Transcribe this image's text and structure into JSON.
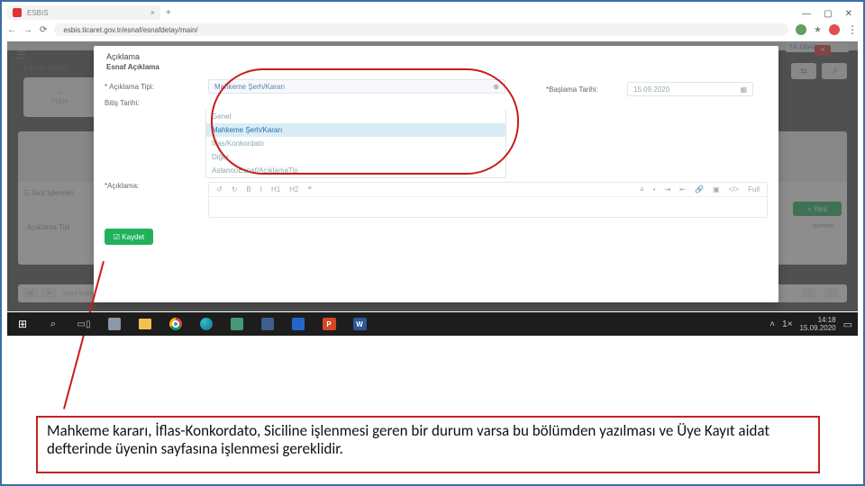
{
  "browser": {
    "tab_title": "ESBIS",
    "url": "esbis.ticaret.gov.tr/esnaf/esnafdetay/main/",
    "win_min": "—",
    "win_max": "▢",
    "win_close": "✕",
    "nav_back": "←",
    "nav_fwd": "→",
    "nav_reload": "⟳"
  },
  "app": {
    "right_card1": "T.K. ODACI",
    "close_x": "×",
    "card_title": "Esnaf Detay",
    "left_card_plus": "+",
    "left_card_label": "Yükle",
    "small_btn_a": "⇆",
    "small_btn_b": "↗",
    "sicil": "☷  Sicil İşlemleri",
    "yeni": "+ Yeni",
    "aciklama_tip_hdr": "Açıklama Tipi",
    "islem": "İşlemler",
    "footer_count": "Kayıt bulunamamaktadır"
  },
  "modal": {
    "title": "Açıklama",
    "subtitle": "Esnaf Açıklama",
    "lbl_tip": "Açıklama Tipi:",
    "lbl_bitis": "Bitiş Tarihi:",
    "lbl_baslama": "Başlama Tarihi:",
    "date_val": "15.09.2020",
    "lbl_aciklama": "Açıklama:",
    "selected": "Mahkeme Şerh/Kararı",
    "opts": [
      "Genel",
      "Mahkeme Şerh/Kararı",
      "İflas/Konkordato",
      "Diğer",
      "AstanooEsnaf/AçıklamaTip"
    ],
    "toolbar": {
      "undo": "↺",
      "redo": "↻",
      "b": "B",
      "i": "I",
      "h1": "H1",
      "h2": "H2",
      "q": "❝",
      "ol": "≡",
      "ul": "•",
      "indent": "⇥",
      "outdent": "⇤",
      "link": "🔗",
      "pic": "▣",
      "code": "</>",
      "full": "Full"
    },
    "kaydet": "☑ Kaydet"
  },
  "taskbar": {
    "time": "14:18",
    "date": "15.09.2020",
    "ppt": "P",
    "word": "W",
    "net": "1×"
  },
  "note": "Mahkeme kararı, İflas-Konkordato, Siciline işlenmesi geren bir durum varsa bu bölümden yazılması ve Üye Kayıt aidat defterinde üyenin sayfasına işlenmesi gereklidir."
}
